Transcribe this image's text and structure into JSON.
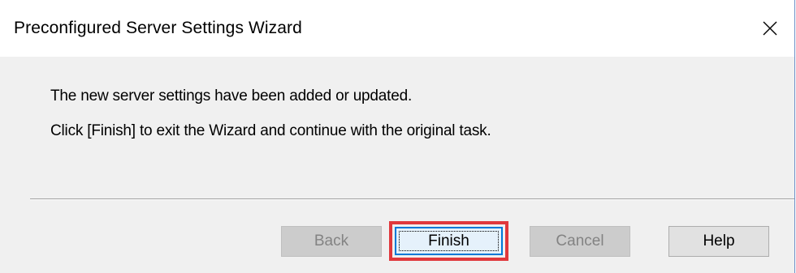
{
  "window": {
    "title": "Preconfigured Server Settings Wizard"
  },
  "message": {
    "line1": "The new server settings have been added or updated.",
    "line2": "Click [Finish] to exit the Wizard and continue with the original task."
  },
  "buttons": {
    "back": "Back",
    "finish": "Finish",
    "cancel": "Cancel",
    "help": "Help"
  },
  "icons": {
    "close": "close-icon"
  },
  "colors": {
    "highlight": "#e0383c",
    "focus_border": "#0078d7"
  }
}
